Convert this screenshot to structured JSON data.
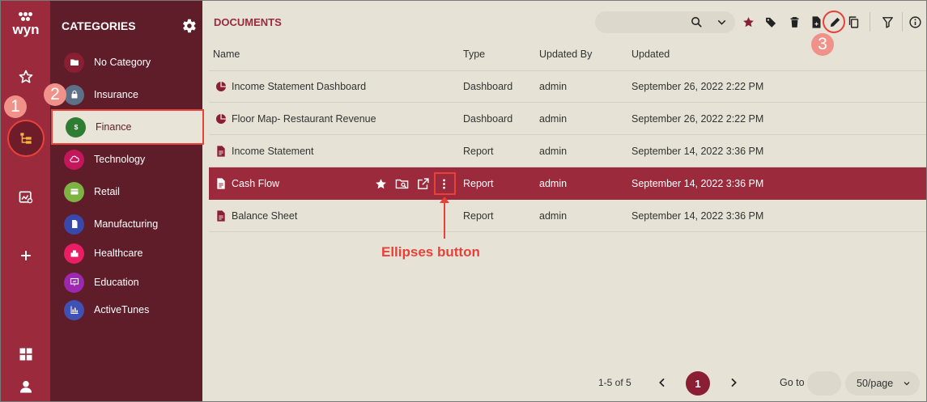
{
  "app": {
    "logo_text": "wyn",
    "colors": {
      "rail": "#9a2a3c",
      "panel": "#5e1d28",
      "main": "#e6e2d6",
      "accent": "#9a2a3c",
      "annotation": "#e8413a"
    }
  },
  "rail": {
    "items": [
      {
        "name": "favorites",
        "icon": "star-icon"
      },
      {
        "name": "documents",
        "icon": "category-tree-icon",
        "active": true
      },
      {
        "name": "reports",
        "icon": "analytics-icon"
      },
      {
        "name": "create",
        "icon": "plus-icon"
      },
      {
        "name": "dashboard",
        "icon": "grid-icon"
      },
      {
        "name": "account",
        "icon": "user-icon"
      }
    ]
  },
  "categories": {
    "title": "CATEGORIES",
    "items": [
      {
        "label": "No Category",
        "icon": "folder-icon",
        "color": "#8a1e32"
      },
      {
        "label": "Insurance",
        "icon": "lock-icon",
        "color": "#5e6f88"
      },
      {
        "label": "Finance",
        "icon": "dollar-icon",
        "color": "#2e7d32",
        "selected": true
      },
      {
        "label": "Technology",
        "icon": "cloud-icon",
        "color": "#c2185b"
      },
      {
        "label": "Retail",
        "icon": "card-icon",
        "color": "#7cb342"
      },
      {
        "label": "Manufacturing",
        "icon": "document-icon",
        "color": "#3949ab"
      },
      {
        "label": "Healthcare",
        "icon": "hospital-icon",
        "color": "#e91e63"
      },
      {
        "label": "Education",
        "icon": "presentation-icon",
        "color": "#9c27b0"
      },
      {
        "label": "ActiveTunes",
        "icon": "bar-chart-icon",
        "color": "#3f51b5"
      }
    ]
  },
  "documents": {
    "title": "DOCUMENTS",
    "columns": {
      "name": "Name",
      "type": "Type",
      "updated_by": "Updated By",
      "updated": "Updated"
    },
    "rows": [
      {
        "name": "Income Statement Dashboard",
        "type": "Dashboard",
        "updated_by": "admin",
        "updated": "September 26, 2022 2:22 PM",
        "icon": "dashboard-icon"
      },
      {
        "name": "Floor Map- Restaurant Revenue",
        "type": "Dashboard",
        "updated_by": "admin",
        "updated": "September 26, 2022 2:22 PM",
        "icon": "dashboard-icon"
      },
      {
        "name": "Income Statement",
        "type": "Report",
        "updated_by": "admin",
        "updated": "September 14, 2022 3:36 PM",
        "icon": "report-icon"
      },
      {
        "name": "Cash Flow",
        "type": "Report",
        "updated_by": "admin",
        "updated": "September 14, 2022 3:36 PM",
        "icon": "report-icon",
        "active": true
      },
      {
        "name": "Balance Sheet",
        "type": "Report",
        "updated_by": "admin",
        "updated": "September 14, 2022 3:36 PM",
        "icon": "report-icon"
      }
    ]
  },
  "pagination": {
    "range_text": "1-5 of 5",
    "current_page": "1",
    "goto_label": "Go to",
    "per_page": "50/page"
  },
  "annotations": {
    "marker_1": "1",
    "marker_2": "2",
    "marker_3": "3",
    "ellipses_label": "Ellipses button"
  }
}
